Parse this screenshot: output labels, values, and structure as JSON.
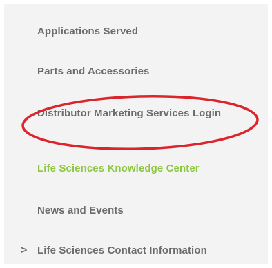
{
  "nav": {
    "items": [
      {
        "label": "Applications Served"
      },
      {
        "label": "Parts and Accessories"
      },
      {
        "label": "Distributor Marketing Services Login"
      },
      {
        "label": "Life Sciences Knowledge Center"
      },
      {
        "label": "News and Events"
      },
      {
        "label": "Life Sciences Contact Information",
        "icon": "chevron-right-icon",
        "icon_glyph": ">"
      }
    ]
  },
  "colors": {
    "text": "#6b6b6b",
    "accent": "#8dc63f",
    "highlight": "#d9252b",
    "panel": "#f3f3f3"
  }
}
